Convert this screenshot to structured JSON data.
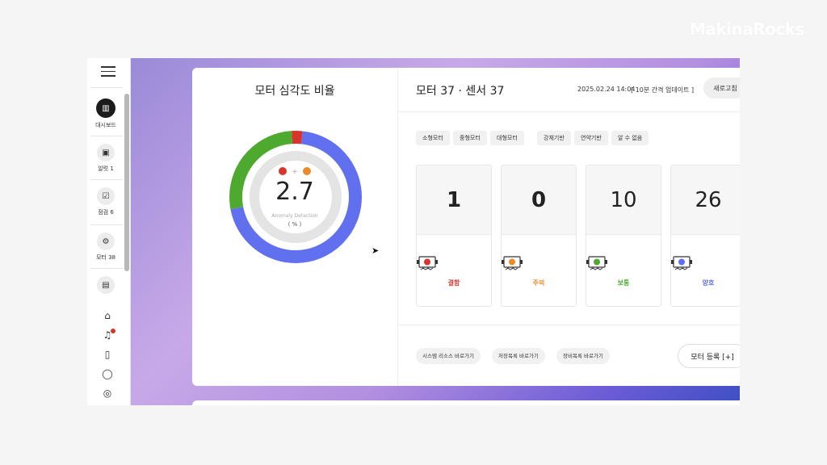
{
  "brand": "MakinaRocks",
  "sidebar": {
    "items": [
      {
        "label": "대시보드",
        "icon": "chart-icon"
      },
      {
        "label": "알럿 1",
        "icon": "alert-list-icon"
      },
      {
        "label": "점검 6",
        "icon": "checklist-icon"
      },
      {
        "label": "모터 38",
        "icon": "motor-icon"
      },
      {
        "label": "",
        "icon": "calendar-icon"
      }
    ]
  },
  "gauge": {
    "title": "모터 심각도 비율",
    "value": "2.7",
    "subtitle": "Anomaly Detection",
    "unit": "( % )",
    "segments": [
      {
        "name": "fault",
        "fraction": 0.027,
        "color": "#d9342b"
      },
      {
        "name": "good",
        "fraction": 0.703,
        "color": "#6170ee"
      },
      {
        "name": "normal",
        "fraction": 0.27,
        "color": "#4eaa2f"
      }
    ]
  },
  "header": {
    "title": "모터 37 · 센서 37",
    "date": "2025.02.24 14:04",
    "update": "[ 10분 간격 업데이트 ]",
    "refresh": "새로고침"
  },
  "filters": [
    "소형모터",
    "중형모터",
    "대형모터",
    "강체기반",
    "연약기반",
    "알 수 없음"
  ],
  "stats": [
    {
      "value": "1",
      "label": "결함",
      "color": "#d9342b"
    },
    {
      "value": "0",
      "label": "주의",
      "color": "#ef8a2a"
    },
    {
      "value": "10",
      "label": "보통",
      "color": "#4eaa2f"
    },
    {
      "value": "26",
      "label": "양호",
      "color": "#6170ee"
    }
  ],
  "shortcuts": [
    "시스템 리소스 바로가기",
    "저장목록 바로가기",
    "장비목록 바로가기"
  ],
  "register": "모터 등록 [+]"
}
